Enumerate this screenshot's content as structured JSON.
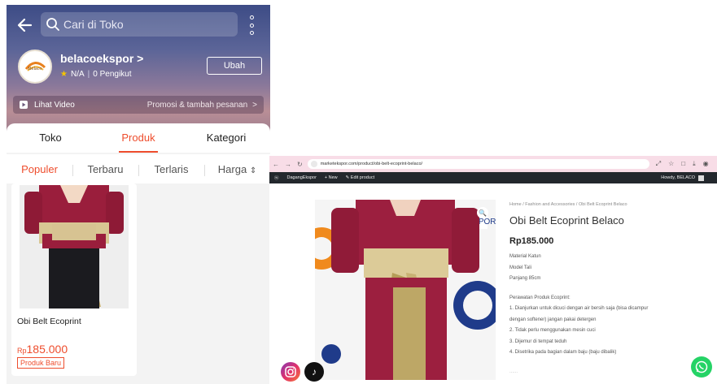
{
  "mobile": {
    "search_placeholder": "Cari di Toko",
    "shop_name": "belacoekspor",
    "shop_arrow": ">",
    "rating": "N/A",
    "followers": "0 Pengikut",
    "edit_button": "Ubah",
    "video_label": "Lihat Video",
    "promo_label": "Promosi & tambah pesanan",
    "promo_arrow": ">",
    "tabs": [
      "Toko",
      "Produk",
      "Kategori"
    ],
    "active_tab": "Produk",
    "sort_options": [
      "Populer",
      "Terbaru",
      "Terlaris",
      "Harga"
    ],
    "active_sort": "Populer",
    "sort_arrows": "⇕",
    "product": {
      "title": "Obi Belt Ecoprint",
      "currency": "Rp",
      "price": "185.000",
      "badge": "Produk Baru"
    },
    "logo_text": "Belaco"
  },
  "browser": {
    "url": "marketekspor.com/product/obi-belt-ecoprint-belaco/",
    "nav_icons": [
      "←",
      "→",
      "↻"
    ],
    "right_icons": [
      "⤢",
      "☆",
      "□",
      "⤓",
      "◉"
    ],
    "wp_items": [
      "DagangEkspor",
      "+ New",
      "✎ Edit product"
    ],
    "howdy": "Howdy, BELACO",
    "breadcrumb": "Home / Fashion and Accessories / Obi Belt Ecoprint Belaco",
    "product_title": "Obi Belt Ecoprint Belaco",
    "price": "Rp185.000",
    "specs": [
      "Material Katun",
      "Model Tali",
      "Panjang 85cm"
    ],
    "care_heading": "Perawatan Produk Ecoprint:",
    "care_steps": [
      "1. Dianjurkan untuk dicuci dengan air bersih saja (bisa dicampur",
      "dengan softener) jangan pakai detergen",
      "2. Tidak perlu menggunakan mesin cuci",
      "3. Dijemur di tempat teduh",
      "4. Disetrika pada bagian dalam baju (baju dibalik)"
    ],
    "more": "......",
    "watermark": "EPC EKSPOR"
  },
  "colors": {
    "accent": "#ee4d2d",
    "wp_bar": "#23282d",
    "whatsapp": "#25d366"
  }
}
